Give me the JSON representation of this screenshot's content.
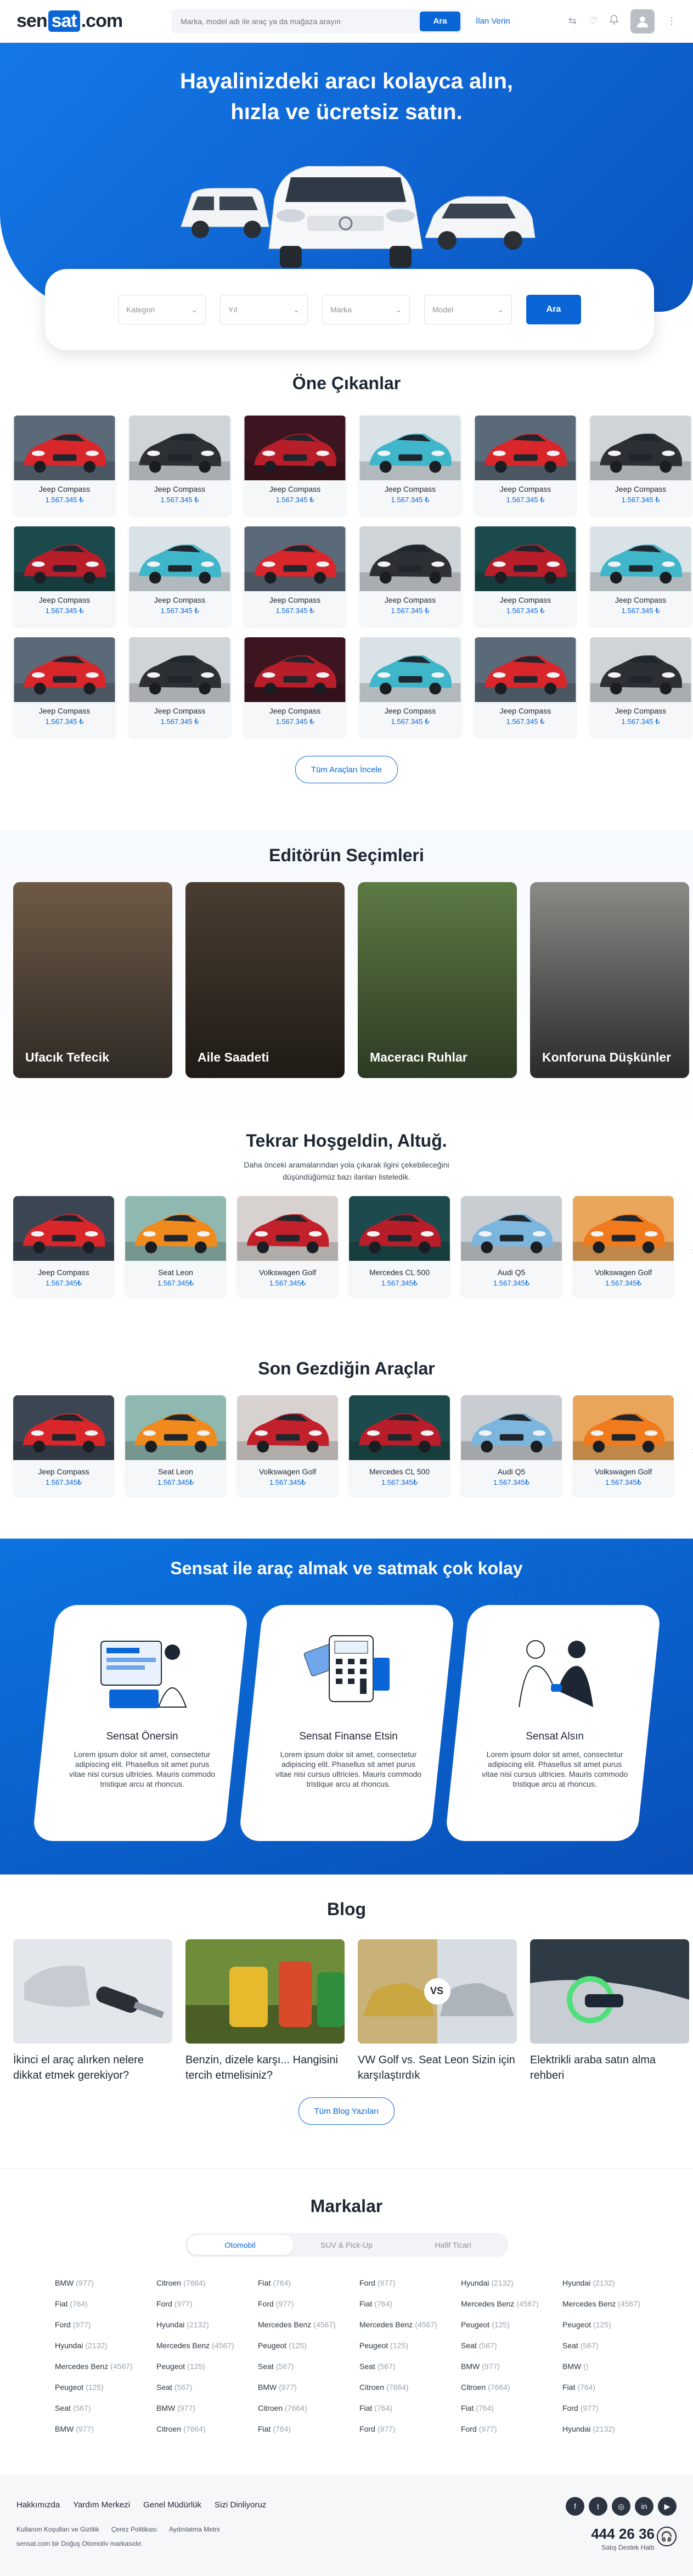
{
  "header": {
    "logo_a": "sen",
    "logo_b": "sat",
    "logo_c": ".com",
    "search_placeholder": "Marka, model adı ile araç ya da mağaza arayın",
    "search_button": "Ara",
    "post_ad": "İlan Verin"
  },
  "hero": {
    "title_line1": "Hayalinizdeki aracı kolayca alın,",
    "title_line2": "hızla ve ücretsiz satın."
  },
  "filter": {
    "category": "Kategori",
    "year": "Yıl",
    "brand": "Marka",
    "model": "Model",
    "button": "Ara"
  },
  "featured": {
    "title": "Öne Çıkanlar",
    "button": "Tüm Araçları İncele",
    "cars": [
      {
        "name": "Jeep Compass",
        "price": "1.567.345 ₺",
        "color": "#d8262b",
        "bg": "#5b6a78"
      },
      {
        "name": "Jeep Compass",
        "price": "1.567.345 ₺",
        "color": "#2c2f33",
        "bg": "#cfd4d9"
      },
      {
        "name": "Jeep Compass",
        "price": "1.567.345 ₺",
        "color": "#b81d2a",
        "bg": "#3d1520"
      },
      {
        "name": "Jeep Compass",
        "price": "1.567.345 ₺",
        "color": "#3fb6c9",
        "bg": "#d9e2e6"
      },
      {
        "name": "Jeep Compass",
        "price": "1.567.345 ₺",
        "color": "#d8262b",
        "bg": "#5b6a78"
      },
      {
        "name": "Jeep Compass",
        "price": "1.567.345 ₺",
        "color": "#2c2f33",
        "bg": "#cfd4d9"
      },
      {
        "name": "Jeep Compass",
        "price": "1.567.345 ₺",
        "color": "#b81d2a",
        "bg": "#1b4a4c"
      },
      {
        "name": "Jeep Compass",
        "price": "1.567.345 ₺",
        "color": "#3fb6c9",
        "bg": "#d9e2e6"
      },
      {
        "name": "Jeep Compass",
        "price": "1.567.345 ₺",
        "color": "#d8262b",
        "bg": "#5b6a78"
      },
      {
        "name": "Jeep Compass",
        "price": "1.567.345 ₺",
        "color": "#2c2f33",
        "bg": "#cfd4d9"
      },
      {
        "name": "Jeep Compass",
        "price": "1.567.345 ₺",
        "color": "#b81d2a",
        "bg": "#1b4a4c"
      },
      {
        "name": "Jeep Compass",
        "price": "1.567.345 ₺",
        "color": "#3fb6c9",
        "bg": "#d9e2e6"
      },
      {
        "name": "Jeep Compass",
        "price": "1.567.345 ₺",
        "color": "#d8262b",
        "bg": "#5b6a78"
      },
      {
        "name": "Jeep Compass",
        "price": "1.567.345 ₺",
        "color": "#2c2f33",
        "bg": "#cfd4d9"
      },
      {
        "name": "Jeep Compass",
        "price": "1.567.345 ₺",
        "color": "#b81d2a",
        "bg": "#3d1520"
      },
      {
        "name": "Jeep Compass",
        "price": "1.567.345 ₺",
        "color": "#3fb6c9",
        "bg": "#d9e2e6"
      },
      {
        "name": "Jeep Compass",
        "price": "1.567.345 ₺",
        "color": "#d8262b",
        "bg": "#5b6a78"
      },
      {
        "name": "Jeep Compass",
        "price": "1.567.345 ₺",
        "color": "#2c2f33",
        "bg": "#cfd4d9"
      }
    ]
  },
  "editor": {
    "title": "Editörün Seçimleri",
    "items": [
      {
        "label": "Ufacık Tefecik",
        "bg1": "#6e5a45",
        "bg2": "#2f2a26"
      },
      {
        "label": "Aile Saadeti",
        "bg1": "#4a3d30",
        "bg2": "#1f1a16"
      },
      {
        "label": "Maceracı Ruhlar",
        "bg1": "#5d7a44",
        "bg2": "#2d3a24"
      },
      {
        "label": "Konforuna Düşkünler",
        "bg1": "#8a8a86",
        "bg2": "#2a2a2a"
      }
    ]
  },
  "welcome": {
    "title": "Tekrar Hoşgeldin, Altuğ.",
    "subtitle_line1": "Daha önceki aramalarından yola çıkarak ilgini çekebileceğini",
    "subtitle_line2": "düşündüğümüz bazı ilanları listeledik.",
    "cars": [
      {
        "name": "Jeep Compass",
        "price": "1.567.345₺",
        "color": "#d8262b",
        "bg": "#3b4652"
      },
      {
        "name": "Seat Leon",
        "price": "1.567.345₺",
        "color": "#f08a1c",
        "bg": "#8fb9b0"
      },
      {
        "name": "Volkswagen Golf",
        "price": "1.567.345₺",
        "color": "#c2202b",
        "bg": "#d7d2cf"
      },
      {
        "name": "Mercedes CL 500",
        "price": "1.567.345₺",
        "color": "#b81d2a",
        "bg": "#1d4b4d"
      },
      {
        "name": "Audi Q5",
        "price": "1.567.345₺",
        "color": "#7cb6de",
        "bg": "#c9ccd0"
      },
      {
        "name": "Volkswagen Golf",
        "price": "1.567.345₺",
        "color": "#f07a1c",
        "bg": "#e9a65a"
      }
    ]
  },
  "recent": {
    "title": "Son Gezdiğin Araçlar",
    "cars": [
      {
        "name": "Jeep Compass",
        "price": "1.567.345₺",
        "color": "#d8262b",
        "bg": "#3b4652"
      },
      {
        "name": "Seat Leon",
        "price": "1.567.345₺",
        "color": "#f08a1c",
        "bg": "#8fb9b0"
      },
      {
        "name": "Volkswagen Golf",
        "price": "1.567.345₺",
        "color": "#c2202b",
        "bg": "#d7d2cf"
      },
      {
        "name": "Mercedes CL 500",
        "price": "1.567.345₺",
        "color": "#b81d2a",
        "bg": "#1d4b4d"
      },
      {
        "name": "Audi Q5",
        "price": "1.567.345₺",
        "color": "#7cb6de",
        "bg": "#c9ccd0"
      },
      {
        "name": "Volkswagen Golf",
        "price": "1.567.345₺",
        "color": "#f07a1c",
        "bg": "#e9a65a"
      }
    ]
  },
  "steps": {
    "title": "Sensat ile araç almak ve satmak çok kolay",
    "items": [
      {
        "title": "Sensat Önersin",
        "text": "Lorem ipsum dolor sit amet, consectetur adipiscing elit. Phasellus sit amet purus vitae nisi cursus ultricies. Mauris commodo tristique arcu at rhoncus."
      },
      {
        "title": "Sensat Finanse Etsin",
        "text": "Lorem ipsum dolor sit amet, consectetur adipiscing elit. Phasellus sit amet purus vitae nisi cursus ultricies. Mauris commodo tristique arcu at rhoncus."
      },
      {
        "title": "Sensat Alsın",
        "text": "Lorem ipsum dolor sit amet, consectetur adipiscing elit. Phasellus sit amet purus vitae nisi cursus ultricies. Mauris commodo tristique arcu at rhoncus."
      }
    ]
  },
  "blog": {
    "title": "Blog",
    "button": "Tüm Blog Yazıları",
    "posts": [
      {
        "title": "İkinci el araç alırken nelere dikkat etmek gerekiyor?",
        "bg": "#e3e6ea"
      },
      {
        "title": "Benzin, dizele karşı... Hangisini tercih etmelisiniz?",
        "bg": "#6f8c3a"
      },
      {
        "title": "VW Golf vs. Seat Leon Sizin için karşılaştırdık",
        "vs": "VS",
        "bg": "#d8dde3"
      },
      {
        "title": "Elektrikli araba satın alma rehberi",
        "bg": "#2e3a44"
      }
    ]
  },
  "brands": {
    "title": "Markalar",
    "tabs": [
      "Otomobil",
      "SUV & Pick-Up",
      "Hafif Ticari"
    ],
    "rows": [
      [
        [
          "BMW",
          "(977)"
        ],
        [
          "Citroen",
          "(7664)"
        ],
        [
          "Fiat",
          "(764)"
        ],
        [
          "Ford",
          "(977)"
        ],
        [
          "Hyundai",
          "(2132)"
        ],
        [
          "Hyundai",
          "(2132)"
        ]
      ],
      [
        [
          "Fiat",
          "(764)"
        ],
        [
          "Ford",
          "(977)"
        ],
        [
          "Ford",
          "(977)"
        ],
        [
          "Fiat",
          "(764)"
        ],
        [
          "Mercedes Benz",
          "(4567)"
        ],
        [
          "Mercedes Benz",
          "(4567)"
        ]
      ],
      [
        [
          "Ford",
          "(977)"
        ],
        [
          "Hyundai",
          "(2132)"
        ],
        [
          "Mercedes Benz",
          "(4567)"
        ],
        [
          "Mercedes Benz",
          "(4567)"
        ],
        [
          "Peugeot",
          "(125)"
        ],
        [
          "Peugeot",
          "(125)"
        ]
      ],
      [
        [
          "Hyundai",
          "(2132)"
        ],
        [
          "Mercedes Benz",
          "(4567)"
        ],
        [
          "Peugeot",
          "(125)"
        ],
        [
          "Peugeot",
          "(125)"
        ],
        [
          "Seat",
          "(567)"
        ],
        [
          "Seat",
          "(567)"
        ]
      ],
      [
        [
          "Mercedes Benz",
          "(4567)"
        ],
        [
          "Peugeot",
          "(125)"
        ],
        [
          "Seat",
          "(567)"
        ],
        [
          "Seat",
          "(567)"
        ],
        [
          "BMW",
          "(977)"
        ],
        [
          "BMW",
          "()"
        ]
      ],
      [
        [
          "Peugeot",
          "(125)"
        ],
        [
          "Seat",
          "(567)"
        ],
        [
          "BMW",
          "(977)"
        ],
        [
          "Citroen",
          "(7664)"
        ],
        [
          "Citroen",
          "(7664)"
        ],
        [
          "Fiat",
          "(764)"
        ]
      ],
      [
        [
          "Seat",
          "(567)"
        ],
        [
          "BMW",
          "(977)"
        ],
        [
          "Citroen",
          "(7664)"
        ],
        [
          "Fiat",
          "(764)"
        ],
        [
          "Fiat",
          "(764)"
        ],
        [
          "Ford",
          "(977)"
        ]
      ],
      [
        [
          "BMW",
          "(977)"
        ],
        [
          "Citroen",
          "(7664)"
        ],
        [
          "Fiat",
          "(764)"
        ],
        [
          "Ford",
          "(977)"
        ],
        [
          "Ford",
          "(977)"
        ],
        [
          "Hyundai",
          "(2132)"
        ]
      ]
    ]
  },
  "footer": {
    "links": [
      "Hakkımızda",
      "Yardım Merkezi",
      "Genel Müdürlük",
      "Sizi Dinliyoruz"
    ],
    "legal": [
      "Kullanım Koşulları ve Gizlilik",
      "Çerez Politikası",
      "Aydınlatma Metni"
    ],
    "copyright": "sensat.com bir Doğuş Otomotiv markasıdır.",
    "phone": "444 26 36",
    "phone_label": "Satış Destek Hattı",
    "social": [
      "f",
      "t",
      "◎",
      "in",
      "▶"
    ]
  },
  "colors": {
    "brand": "#0a66d6",
    "dark": "#1d2733"
  }
}
